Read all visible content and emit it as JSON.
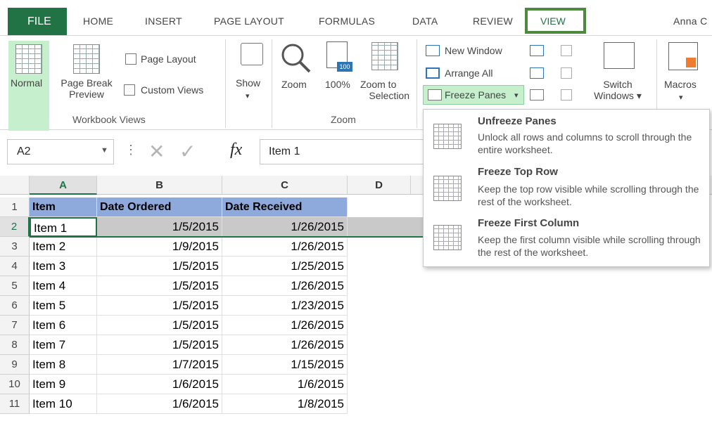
{
  "ribbon": {
    "tabs": [
      "FILE",
      "HOME",
      "INSERT",
      "PAGE LAYOUT",
      "FORMULAS",
      "DATA",
      "REVIEW",
      "VIEW"
    ],
    "user": "Anna C",
    "workbook_views": {
      "normal": "Normal",
      "page_break_1": "Page Break",
      "page_break_2": "Preview",
      "page_layout": "Page Layout",
      "custom_views": "Custom Views",
      "group": "Workbook Views"
    },
    "show": "Show",
    "zoom": {
      "zoom": "Zoom",
      "pct": "100%",
      "pct_badge": "100",
      "zoom_sel_1": "Zoom to",
      "zoom_sel_2": "Selection",
      "group": "Zoom"
    },
    "window": {
      "new_window": "New Window",
      "arrange_all": "Arrange All",
      "freeze_panes": "Freeze Panes",
      "switch_1": "Switch",
      "switch_2": "Windows",
      "macros": "Macros"
    }
  },
  "formula_bar": {
    "name_box": "A2",
    "fx": "fx",
    "value": "Item 1"
  },
  "columns": [
    "A",
    "B",
    "C",
    "D"
  ],
  "header_row": [
    "Item",
    "Date  Ordered",
    "Date Received"
  ],
  "rows": [
    [
      "Item 1",
      "1/5/2015",
      "1/26/2015"
    ],
    [
      "Item 2",
      "1/9/2015",
      "1/26/2015"
    ],
    [
      "Item 3",
      "1/5/2015",
      "1/25/2015"
    ],
    [
      "Item 4",
      "1/5/2015",
      "1/26/2015"
    ],
    [
      "Item 5",
      "1/5/2015",
      "1/23/2015"
    ],
    [
      "Item 6",
      "1/5/2015",
      "1/26/2015"
    ],
    [
      "Item 7",
      "1/5/2015",
      "1/26/2015"
    ],
    [
      "Item 8",
      "1/7/2015",
      "1/15/2015"
    ],
    [
      "Item 9",
      "1/6/2015",
      "1/6/2015"
    ],
    [
      "Item 10",
      "1/6/2015",
      "1/8/2015"
    ]
  ],
  "row_numbers": [
    "1",
    "2",
    "3",
    "4",
    "5",
    "6",
    "7",
    "8",
    "9",
    "10",
    "11"
  ],
  "freeze_menu": [
    {
      "title": "Unfreeze Panes",
      "desc": "Unlock all rows and columns to scroll through the entire worksheet."
    },
    {
      "title": "Freeze Top Row",
      "desc": "Keep the top row visible while scrolling through the rest of the worksheet."
    },
    {
      "title": "Freeze First Column",
      "desc": "Keep the first column visible while scrolling through the rest of the worksheet."
    }
  ],
  "colors": {
    "excel_green": "#217346",
    "header_fill": "#8ea9db",
    "selected_row": "#c9c9c9",
    "view_highlight": "#4e8a3e"
  }
}
